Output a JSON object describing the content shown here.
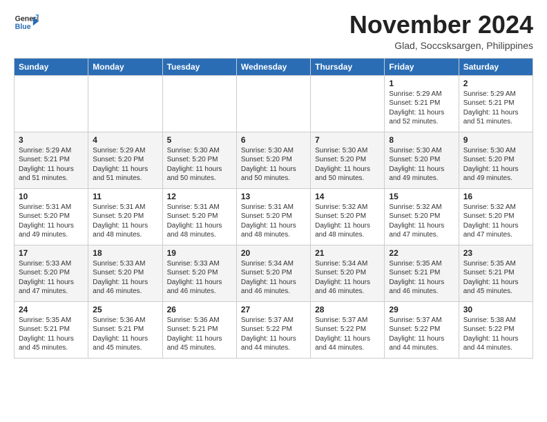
{
  "logo": {
    "general": "General",
    "blue": "Blue"
  },
  "header": {
    "month_year": "November 2024",
    "location": "Glad, Soccsksargen, Philippines"
  },
  "days_of_week": [
    "Sunday",
    "Monday",
    "Tuesday",
    "Wednesday",
    "Thursday",
    "Friday",
    "Saturday"
  ],
  "weeks": [
    [
      {
        "day": "",
        "info": ""
      },
      {
        "day": "",
        "info": ""
      },
      {
        "day": "",
        "info": ""
      },
      {
        "day": "",
        "info": ""
      },
      {
        "day": "",
        "info": ""
      },
      {
        "day": "1",
        "info": "Sunrise: 5:29 AM\nSunset: 5:21 PM\nDaylight: 11 hours and 52 minutes."
      },
      {
        "day": "2",
        "info": "Sunrise: 5:29 AM\nSunset: 5:21 PM\nDaylight: 11 hours and 51 minutes."
      }
    ],
    [
      {
        "day": "3",
        "info": "Sunrise: 5:29 AM\nSunset: 5:21 PM\nDaylight: 11 hours and 51 minutes."
      },
      {
        "day": "4",
        "info": "Sunrise: 5:29 AM\nSunset: 5:20 PM\nDaylight: 11 hours and 51 minutes."
      },
      {
        "day": "5",
        "info": "Sunrise: 5:30 AM\nSunset: 5:20 PM\nDaylight: 11 hours and 50 minutes."
      },
      {
        "day": "6",
        "info": "Sunrise: 5:30 AM\nSunset: 5:20 PM\nDaylight: 11 hours and 50 minutes."
      },
      {
        "day": "7",
        "info": "Sunrise: 5:30 AM\nSunset: 5:20 PM\nDaylight: 11 hours and 50 minutes."
      },
      {
        "day": "8",
        "info": "Sunrise: 5:30 AM\nSunset: 5:20 PM\nDaylight: 11 hours and 49 minutes."
      },
      {
        "day": "9",
        "info": "Sunrise: 5:30 AM\nSunset: 5:20 PM\nDaylight: 11 hours and 49 minutes."
      }
    ],
    [
      {
        "day": "10",
        "info": "Sunrise: 5:31 AM\nSunset: 5:20 PM\nDaylight: 11 hours and 49 minutes."
      },
      {
        "day": "11",
        "info": "Sunrise: 5:31 AM\nSunset: 5:20 PM\nDaylight: 11 hours and 48 minutes."
      },
      {
        "day": "12",
        "info": "Sunrise: 5:31 AM\nSunset: 5:20 PM\nDaylight: 11 hours and 48 minutes."
      },
      {
        "day": "13",
        "info": "Sunrise: 5:31 AM\nSunset: 5:20 PM\nDaylight: 11 hours and 48 minutes."
      },
      {
        "day": "14",
        "info": "Sunrise: 5:32 AM\nSunset: 5:20 PM\nDaylight: 11 hours and 48 minutes."
      },
      {
        "day": "15",
        "info": "Sunrise: 5:32 AM\nSunset: 5:20 PM\nDaylight: 11 hours and 47 minutes."
      },
      {
        "day": "16",
        "info": "Sunrise: 5:32 AM\nSunset: 5:20 PM\nDaylight: 11 hours and 47 minutes."
      }
    ],
    [
      {
        "day": "17",
        "info": "Sunrise: 5:33 AM\nSunset: 5:20 PM\nDaylight: 11 hours and 47 minutes."
      },
      {
        "day": "18",
        "info": "Sunrise: 5:33 AM\nSunset: 5:20 PM\nDaylight: 11 hours and 46 minutes."
      },
      {
        "day": "19",
        "info": "Sunrise: 5:33 AM\nSunset: 5:20 PM\nDaylight: 11 hours and 46 minutes."
      },
      {
        "day": "20",
        "info": "Sunrise: 5:34 AM\nSunset: 5:20 PM\nDaylight: 11 hours and 46 minutes."
      },
      {
        "day": "21",
        "info": "Sunrise: 5:34 AM\nSunset: 5:20 PM\nDaylight: 11 hours and 46 minutes."
      },
      {
        "day": "22",
        "info": "Sunrise: 5:35 AM\nSunset: 5:21 PM\nDaylight: 11 hours and 46 minutes."
      },
      {
        "day": "23",
        "info": "Sunrise: 5:35 AM\nSunset: 5:21 PM\nDaylight: 11 hours and 45 minutes."
      }
    ],
    [
      {
        "day": "24",
        "info": "Sunrise: 5:35 AM\nSunset: 5:21 PM\nDaylight: 11 hours and 45 minutes."
      },
      {
        "day": "25",
        "info": "Sunrise: 5:36 AM\nSunset: 5:21 PM\nDaylight: 11 hours and 45 minutes."
      },
      {
        "day": "26",
        "info": "Sunrise: 5:36 AM\nSunset: 5:21 PM\nDaylight: 11 hours and 45 minutes."
      },
      {
        "day": "27",
        "info": "Sunrise: 5:37 AM\nSunset: 5:22 PM\nDaylight: 11 hours and 44 minutes."
      },
      {
        "day": "28",
        "info": "Sunrise: 5:37 AM\nSunset: 5:22 PM\nDaylight: 11 hours and 44 minutes."
      },
      {
        "day": "29",
        "info": "Sunrise: 5:37 AM\nSunset: 5:22 PM\nDaylight: 11 hours and 44 minutes."
      },
      {
        "day": "30",
        "info": "Sunrise: 5:38 AM\nSunset: 5:22 PM\nDaylight: 11 hours and 44 minutes."
      }
    ]
  ]
}
